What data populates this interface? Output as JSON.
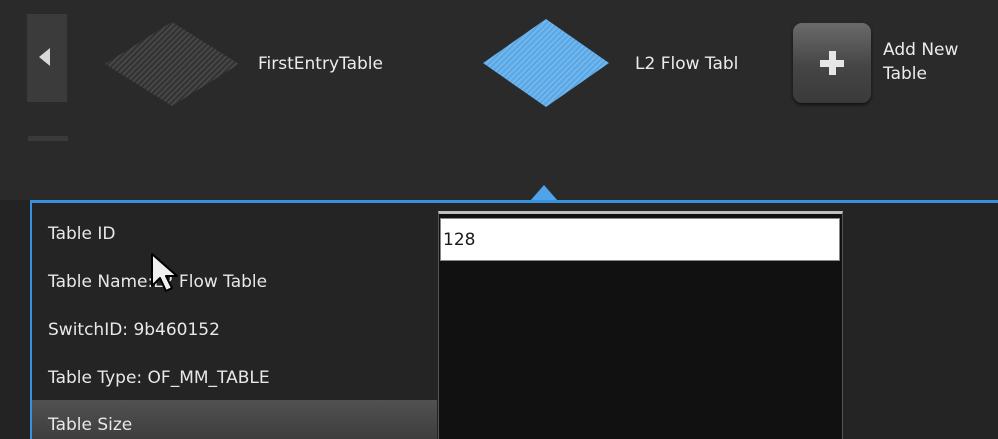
{
  "carousel": {
    "tables": [
      {
        "label": "FirstEntryTable",
        "state": "inactive"
      },
      {
        "label": "L2 Flow Tabl",
        "state": "selected"
      }
    ],
    "add_button_label": "Add New Table",
    "add_button_label_line1": "Add New",
    "add_button_label_line2": "Table"
  },
  "properties": {
    "table_id": "Table ID",
    "table_name": "Table Name:L2 Flow Table",
    "switch_id": "SwitchID: 9b460152",
    "table_type": "Table Type: OF_MM_TABLE",
    "table_size": "Table Size"
  },
  "editor": {
    "value": "128"
  },
  "colors": {
    "accent": "#3a90e0",
    "selected_diamond": "#5ba8e6",
    "inactive_diamond": "#3c3c3c"
  },
  "icons": [
    "left-arrow-icon",
    "table-diamond-icon",
    "plus-icon",
    "mouse-cursor-icon"
  ]
}
